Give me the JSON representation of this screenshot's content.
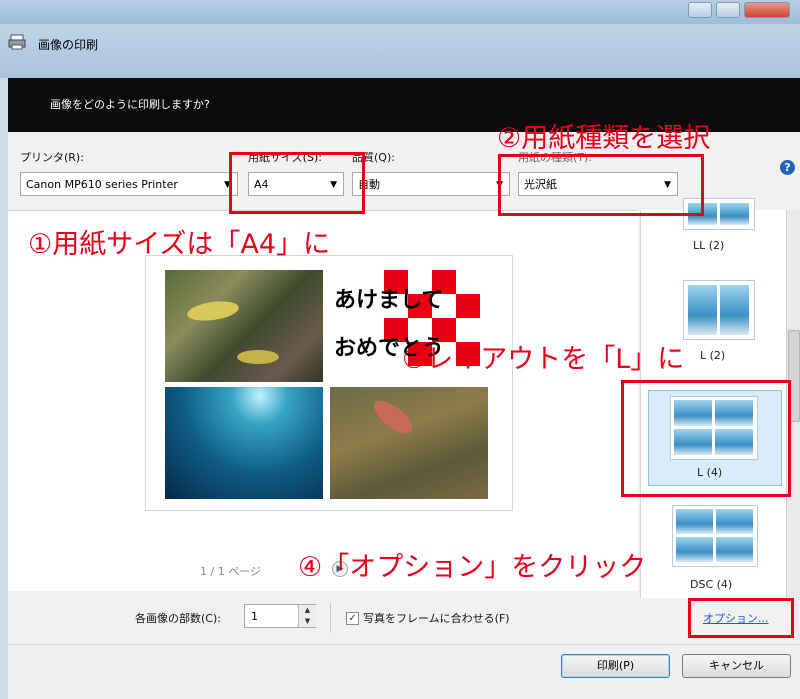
{
  "window": {
    "title": "画像の印刷",
    "header_question": "画像をどのように印刷しますか?"
  },
  "printer": {
    "label": "プリンタ(R):",
    "value": "Canon MP610 series Printer"
  },
  "paper_size": {
    "label": "用紙サイズ(S):",
    "value": "A4"
  },
  "quality": {
    "label": "品質(Q):",
    "value": "自動"
  },
  "paper_type": {
    "label": "用紙の種類(T):",
    "value": "光沢紙"
  },
  "preview": {
    "page_indicator": "1 / 1 ページ"
  },
  "layouts": [
    {
      "label": "LL (2)"
    },
    {
      "label": "L (2)"
    },
    {
      "label": "L (4)",
      "selected": true
    },
    {
      "label": "DSC (4)"
    }
  ],
  "copies": {
    "label": "各画像の部数(C):",
    "value": "1"
  },
  "fit_to_frame": {
    "label": "写真をフレームに合わせる(F)",
    "checked": true
  },
  "options_link": "オプション...",
  "buttons": {
    "print": "印刷(P)",
    "cancel": "キャンセル"
  },
  "annotations": {
    "step1": "①用紙サイズは「A4」に",
    "step2": "②用紙種類を選択",
    "step3": "③レイアウトを「L」に",
    "step4": "④「オプション」をクリック"
  },
  "photo_text": {
    "line1": "あけまして",
    "line2": "おめでとう"
  },
  "colors": {
    "annotation_red": "#e4001b",
    "link_blue": "#1b5bd1",
    "header_bg": "#0c0c0c"
  }
}
